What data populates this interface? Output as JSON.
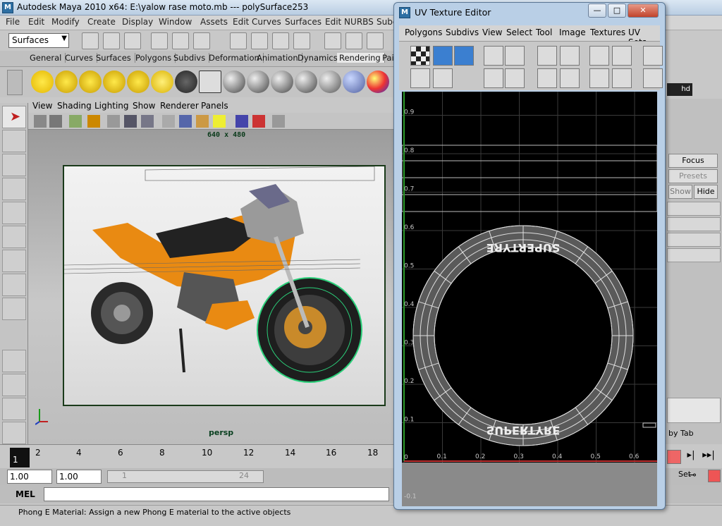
{
  "maya_window": {
    "logo": "M",
    "title": "Autodesk Maya 2010 x64: E:\\yalow rase moto.mb   ---   polySurface253"
  },
  "main_menu": [
    "File",
    "Edit",
    "Modify",
    "Create",
    "Display",
    "Window",
    "Assets",
    "Edit Curves",
    "Surfaces",
    "Edit NURBS",
    "Subd"
  ],
  "menu_set_selector": {
    "value": "Surfaces"
  },
  "shelf_tabs": [
    "General",
    "Curves",
    "Surfaces",
    "Polygons",
    "Subdivs",
    "Deformation",
    "Animation",
    "Dynamics",
    "Rendering",
    "Pai"
  ],
  "active_shelf_tab": "Rendering",
  "viewport": {
    "menu": [
      "View",
      "Shading",
      "Lighting",
      "Show",
      "Renderer",
      "Panels"
    ],
    "resolution_label": "640 x 480",
    "camera_label": "persp"
  },
  "timeline": {
    "ticks": [
      "1",
      "2",
      "4",
      "6",
      "8",
      "10",
      "12",
      "14",
      "16",
      "18"
    ],
    "current_frame": "1"
  },
  "range": {
    "start_field": "1.00",
    "playback_start": "1.00",
    "slider_left": "1",
    "slider_right": "24"
  },
  "command_line": {
    "label": "MEL",
    "value": ""
  },
  "help_line": "Phong E Material: Assign a new Phong E material to the active objects",
  "right_panel": {
    "focus_button": "Focus",
    "presets_button": "Presets",
    "show_button": "Show",
    "hide_button": "Hide",
    "tab_label": "by Tab",
    "set_label": "Set",
    "hd_label": "hd"
  },
  "uv_editor": {
    "logo": "M",
    "title": "UV Texture Editor",
    "minimize": "—",
    "maximize": "□",
    "close": "✕",
    "menu": [
      "Polygons",
      "Subdivs",
      "View",
      "Select",
      "Tool",
      "Image",
      "Textures",
      "UV Sets"
    ],
    "y_axis_labels": [
      "0.9",
      "0.8",
      "0.7",
      "0.6",
      "0.5",
      "0.4",
      "0.3",
      "0.2",
      "0.1",
      "0",
      "-0.1"
    ],
    "x_axis_labels": [
      "0",
      "0.1",
      "0.2",
      "0.3",
      "0.4",
      "0.5",
      "0.6"
    ],
    "texture_text_top": "SUPERTYRE",
    "texture_text_bottom": "SUPERTYRE"
  },
  "colors": {
    "uv_background": "#000000",
    "u_axis": "#c03030",
    "v_axis": "#2a9a2a",
    "selected_wire": "#2bd07a",
    "bike_orange": "#e98a12"
  }
}
